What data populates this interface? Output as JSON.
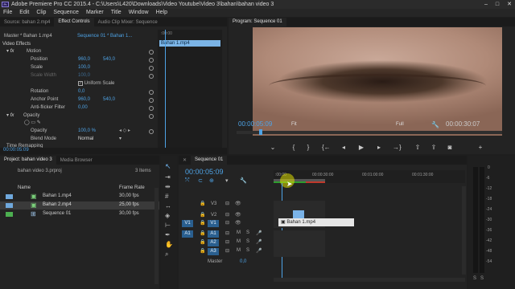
{
  "app": {
    "title": "Adobe Premiere Pro CC 2015.4 - C:\\Users\\L420\\Downloads\\Video Youtube\\Video 3\\bahan\\bahan video 3",
    "icon_text": "Pr"
  },
  "menu": [
    "File",
    "Edit",
    "Clip",
    "Sequence",
    "Marker",
    "Title",
    "Window",
    "Help"
  ],
  "source_panel": {
    "tabs": [
      "Source: bahan 2.mp4",
      "Effect Controls",
      "Audio Clip Mixer: Sequence"
    ],
    "master_label": "Master * Bahan 1.mp4",
    "seq_label": "Sequence 01 * Bahan 1...",
    "clip_label": "Bahan 1.mp4",
    "ruler_time": ":00:00",
    "section_video": "Video Effects",
    "motion": "Motion",
    "props": [
      {
        "name": "Position",
        "v1": "960,0",
        "v2": "540,0"
      },
      {
        "name": "Scale",
        "v1": "100,0",
        "v2": ""
      },
      {
        "name": "Scale Width",
        "v1": "100,0",
        "v2": ""
      },
      {
        "name": "Uniform Scale",
        "v1": "",
        "v2": ""
      },
      {
        "name": "Rotation",
        "v1": "0,0",
        "v2": ""
      },
      {
        "name": "Anchor Point",
        "v1": "960,0",
        "v2": "540,0"
      },
      {
        "name": "Anti-flicker Filter",
        "v1": "0,00",
        "v2": ""
      }
    ],
    "opacity": "Opacity",
    "opacity_value": "100,0 %",
    "blend_mode_label": "Blend Mode",
    "blend_mode_value": "Normal",
    "time_remap": "Time Remapping",
    "timecode": "00:00:05:09"
  },
  "program": {
    "tab": "Program: Sequence 01",
    "timecode": "00:00:05:09",
    "fit": "Fit",
    "quality": "Full",
    "duration": "00:00:30:07"
  },
  "project": {
    "tabs": [
      "Project: bahan video 3",
      "Media Browser"
    ],
    "file": "bahan video 3.prproj",
    "count": "3 Items",
    "col_name": "Name",
    "col_rate": "Frame Rate",
    "items": [
      {
        "name": "Bahan 1.mp4",
        "rate": "30,00 fps",
        "color": "#6fa8dc"
      },
      {
        "name": "Bahan 2.mp4",
        "rate": "25,00 fps",
        "color": "#6fa8dc"
      },
      {
        "name": "Sequence 01",
        "rate": "30,00 fps",
        "color": "#4caf50"
      }
    ]
  },
  "timeline": {
    "tab": "Sequence 01",
    "timecode": "00:00:05:09",
    "ruler": [
      ":00:00",
      "00:00:30:00",
      "00:01:00:00",
      "00:01:30:00"
    ],
    "video_tracks": [
      "V3",
      "V2",
      "V1"
    ],
    "audio_tracks": [
      "A1",
      "A2",
      "A3"
    ],
    "clip_name": "Bahan 1.mp4",
    "master": "Master",
    "master_val": "0,0"
  },
  "meter": {
    "labels": [
      "0",
      "-6",
      "-12",
      "-18",
      "-24",
      "-30",
      "-36",
      "-42",
      "-48",
      "-54"
    ],
    "footer": [
      "S",
      "S"
    ]
  }
}
